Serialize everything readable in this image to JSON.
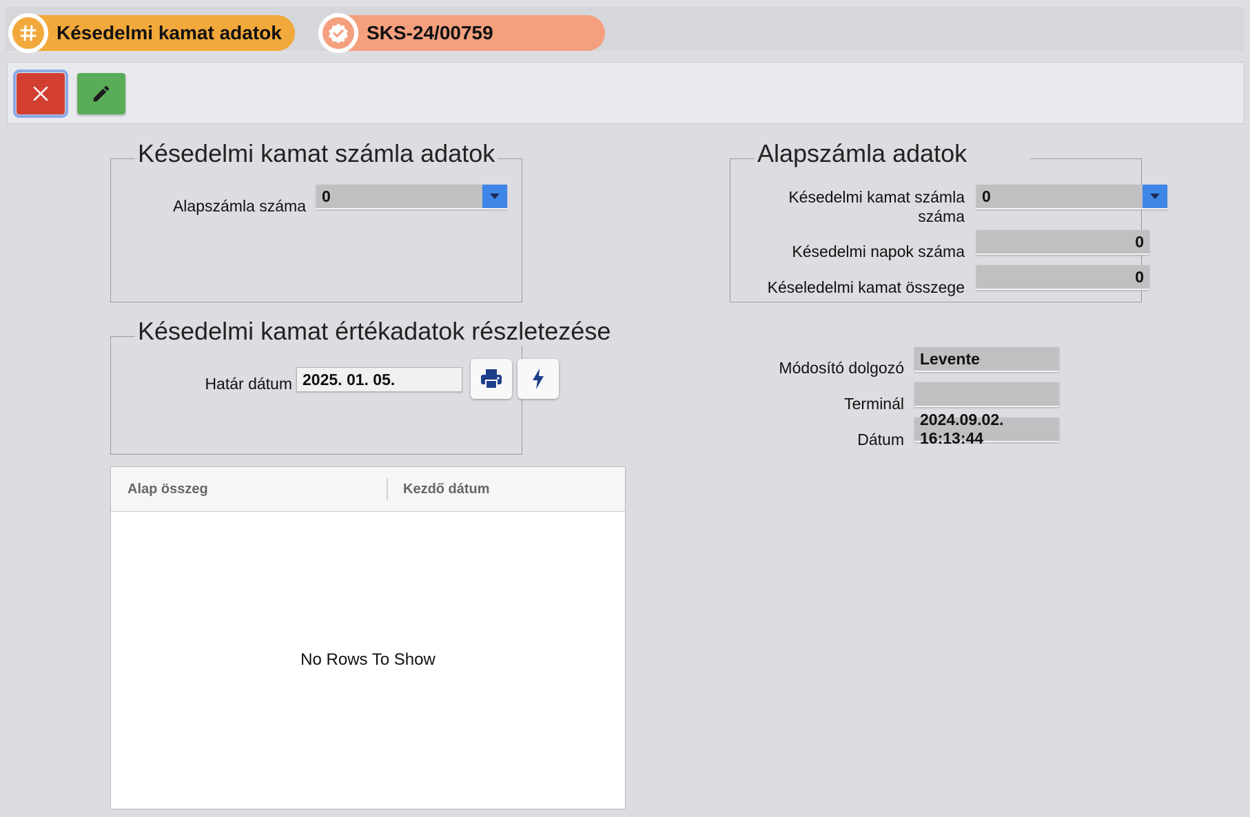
{
  "tabs": [
    {
      "label": "Késedelmi kamat adatok",
      "icon": "hash-icon"
    },
    {
      "label": "SKS-24/00759",
      "icon": "verified-badge-icon"
    }
  ],
  "toolbar": {
    "close_icon": "close-icon",
    "edit_icon": "pencil-icon"
  },
  "invoice_section": {
    "legend": "Késedelmi kamat számla adatok",
    "base_invoice_label": "Alapszámla száma",
    "base_invoice_value": "0"
  },
  "base_section": {
    "legend": "Alapszámla adatok",
    "interest_invoice_label_line1": "Késedelmi kamat számla",
    "interest_invoice_label_line2": "száma",
    "interest_invoice_value": "0",
    "late_days_label": "Késedelmi napok száma",
    "late_days_value": "0",
    "interest_amount_label": "Késeledelmi kamat összege",
    "interest_amount_value": "0"
  },
  "details_section": {
    "legend": "Késedelmi kamat értékadatok részletezése",
    "deadline_label": "Határ dátum",
    "deadline_value": "2025. 01. 05."
  },
  "meta": {
    "modifier_label": "Módosító dolgozó",
    "modifier_value": "Levente",
    "terminal_label": "Terminál",
    "terminal_value": "",
    "date_label": "Dátum",
    "date_value": "2024.09.02. 16:13:44"
  },
  "grid": {
    "columns": [
      "Alap összeg",
      "Kezdő dátum"
    ],
    "empty_text": "No Rows To Show"
  },
  "colors": {
    "tab1": "#f2a93b",
    "tab2": "#f4a07f",
    "close_button": "#d23f31",
    "edit_button": "#5aad58",
    "dropdown_accent": "#3f85e6"
  }
}
